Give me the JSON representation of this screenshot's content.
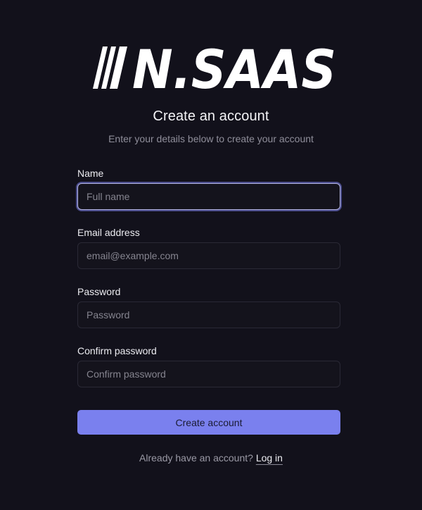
{
  "brand": {
    "logo_text": "/N.SAAS",
    "logo_color": "#ffffff"
  },
  "header": {
    "title": "Create an account",
    "subtitle": "Enter your details below to create your account"
  },
  "form": {
    "name": {
      "label": "Name",
      "placeholder": "Full name",
      "value": ""
    },
    "email": {
      "label": "Email address",
      "placeholder": "email@example.com",
      "value": ""
    },
    "password": {
      "label": "Password",
      "placeholder": "Password",
      "value": ""
    },
    "confirm_password": {
      "label": "Confirm password",
      "placeholder": "Confirm password",
      "value": ""
    },
    "submit_label": "Create account"
  },
  "footer": {
    "prompt": "Already have an account?",
    "link_label": "Log in"
  },
  "colors": {
    "background": "#12111b",
    "accent": "#7a80ee",
    "focus_ring": "#4b4d8c"
  }
}
